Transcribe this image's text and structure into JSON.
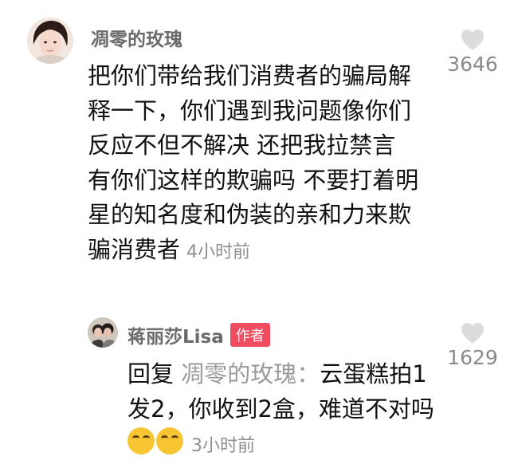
{
  "comment": {
    "username": "凋零的玫瑰",
    "text": "把你们带给我们消费者的骗局解释一下，你们遇到我问题像你们反应不但不解决 还把我拉禁言 有你们这样的欺骗吗 不要打着明星的知名度和伪装的亲和力来欺骗消费者",
    "time": "4小时前",
    "likes": "3646"
  },
  "reply": {
    "username": "蒋丽莎Lisa",
    "badge": "作者",
    "prefix": "回复",
    "target": "凋零的玫瑰：",
    "text": "云蛋糕拍1发2，你收到2盒，难道不对吗",
    "time": "3小时前",
    "likes": "1629"
  },
  "colors": {
    "badge": "#f04b5e",
    "username": "#6b6b6b",
    "muted": "#9a9a9a"
  },
  "icons": [
    "heart-icon",
    "laugh-cry-emoji"
  ]
}
